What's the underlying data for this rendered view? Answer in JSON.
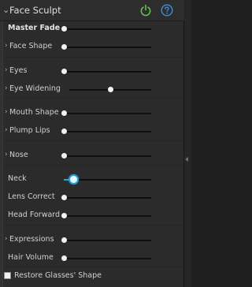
{
  "header": {
    "chevron": "⌄",
    "title": "Face Sculpt",
    "power_icon": "power-icon",
    "help_icon": "help-icon",
    "power_color": "#66c250",
    "help_color": "#3d8fd8"
  },
  "sliders": [
    {
      "id": "master-fade",
      "label": "Master Fade",
      "bold": true,
      "expandable": false,
      "value": 0.0
    },
    {
      "id": "face-shape",
      "label": "Face Shape",
      "bold": false,
      "expandable": true,
      "value": 0.0
    },
    {
      "id": "eyes",
      "label": "Eyes",
      "bold": false,
      "expandable": true,
      "value": 0.0
    },
    {
      "id": "eye-widening",
      "label": "Eye Widening",
      "bold": false,
      "expandable": true,
      "value": 0.5
    },
    {
      "id": "mouth-shape",
      "label": "Mouth Shape",
      "bold": false,
      "expandable": true,
      "value": 0.0
    },
    {
      "id": "plump-lips",
      "label": "Plump Lips",
      "bold": false,
      "expandable": true,
      "value": 0.0
    },
    {
      "id": "nose",
      "label": "Nose",
      "bold": false,
      "expandable": true,
      "value": 0.0
    },
    {
      "id": "neck",
      "label": "Neck",
      "bold": false,
      "expandable": false,
      "value": 0.11,
      "active": true
    },
    {
      "id": "lens-correct",
      "label": "Lens Correct",
      "bold": false,
      "expandable": false,
      "value": 0.0
    },
    {
      "id": "head-forward",
      "label": "Head Forward",
      "bold": false,
      "expandable": false,
      "value": 0.0
    },
    {
      "id": "expressions",
      "label": "Expressions",
      "bold": false,
      "expandable": true,
      "value": 0.0
    },
    {
      "id": "hair-volume",
      "label": "Hair Volume",
      "bold": false,
      "expandable": false,
      "value": 0.0
    }
  ],
  "checkbox": {
    "label": "Restore Glasses' Shape",
    "checked": false
  },
  "accent_color": "#2ea3d6"
}
